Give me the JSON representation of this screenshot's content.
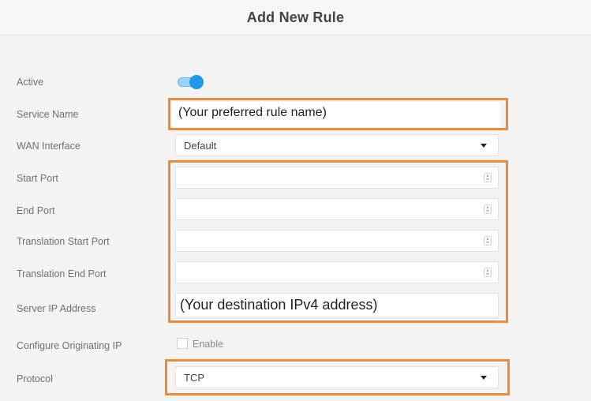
{
  "header": {
    "title": "Add New Rule"
  },
  "form": {
    "active_label": "Active",
    "service_name_label": "Service Name",
    "service_name_value": "(Your preferred rule name)",
    "wan_interface_label": "WAN Interface",
    "wan_interface_value": "Default",
    "start_port_label": "Start Port",
    "end_port_label": "End Port",
    "translation_start_port_label": "Translation Start Port",
    "translation_end_port_label": "Translation End Port",
    "server_ip_label": "Server IP Address",
    "server_ip_value": "(Your destination IPv4 address)",
    "configure_originating_ip_label": "Configure Originating IP",
    "enable_label": "Enable",
    "protocol_label": "Protocol",
    "protocol_value": "TCP"
  },
  "colors": {
    "highlight": "#ee8a3a",
    "toggle_on": "#1e9ae8"
  },
  "icons": [
    "toggle-switch",
    "dropdown-caret-icon",
    "spinner-icon",
    "checkbox"
  ]
}
